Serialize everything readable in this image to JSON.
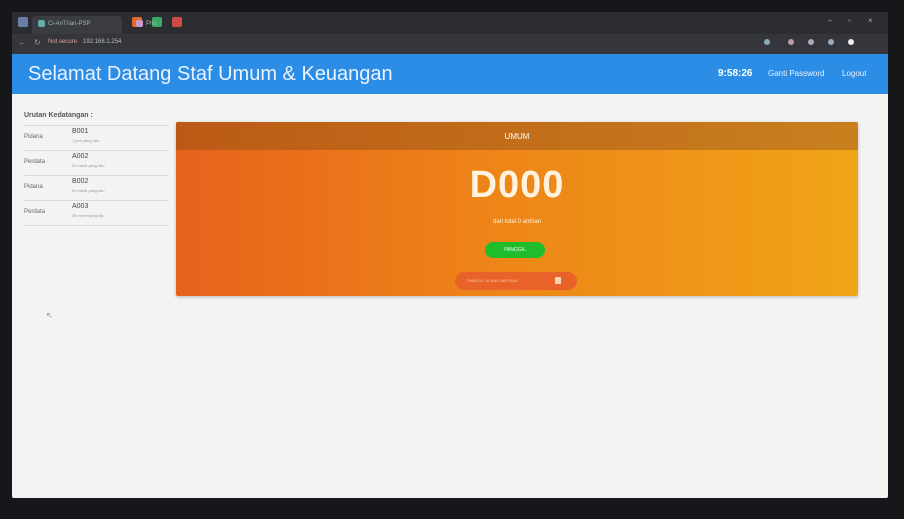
{
  "browser": {
    "tab_title": "Ci-AnTrian-PSP",
    "tab2_title": "Prin",
    "security": "Not secure",
    "url": "192.168.1.254"
  },
  "header": {
    "title": "Selamat Datang Staf Umum & Keuangan",
    "clock": "9:58:26",
    "change_password": "Ganti Password",
    "logout": "Logout"
  },
  "sidebar": {
    "title": "Urutan Kedatangan :",
    "items": [
      {
        "location": "Pidana",
        "code": "B001",
        "time": "1 jam yang lalu"
      },
      {
        "location": "Perdata",
        "code": "A002",
        "time": "53 menit yang lalu"
      },
      {
        "location": "Pidana",
        "code": "B002",
        "time": "50 menit yang lalu"
      },
      {
        "location": "Perdata",
        "code": "A003",
        "time": "35 menit yang lalu"
      }
    ]
  },
  "queue": {
    "heading": "UMUM",
    "number": "D000",
    "subtitle": "dari total 0 antrian",
    "call_button": "PANGGIL",
    "other_button": "PANGGIL ULANG ANTRIAN"
  }
}
